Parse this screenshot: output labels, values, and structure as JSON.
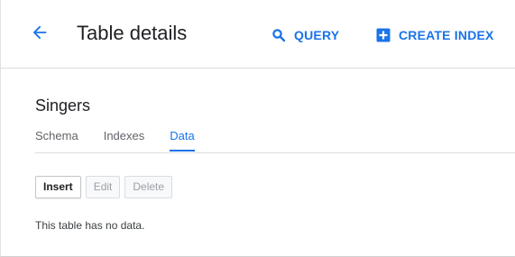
{
  "header": {
    "title": "Table details",
    "actions": {
      "query_label": "QUERY",
      "create_index_label": "CREATE INDEX"
    }
  },
  "table": {
    "name": "Singers",
    "tabs": [
      {
        "label": "Schema",
        "active": false
      },
      {
        "label": "Indexes",
        "active": false
      },
      {
        "label": "Data",
        "active": true
      }
    ],
    "buttons": {
      "insert_label": "Insert",
      "edit_label": "Edit",
      "delete_label": "Delete"
    },
    "empty_message": "This table has no data."
  },
  "icons": {
    "back": "arrow-back-icon",
    "query": "search-icon",
    "create_index": "add-box-icon"
  },
  "colors": {
    "accent": "#1a73e8",
    "text": "#202124",
    "muted": "#5f6368",
    "disabled": "#9aa0a6",
    "divider": "#dadce0"
  }
}
